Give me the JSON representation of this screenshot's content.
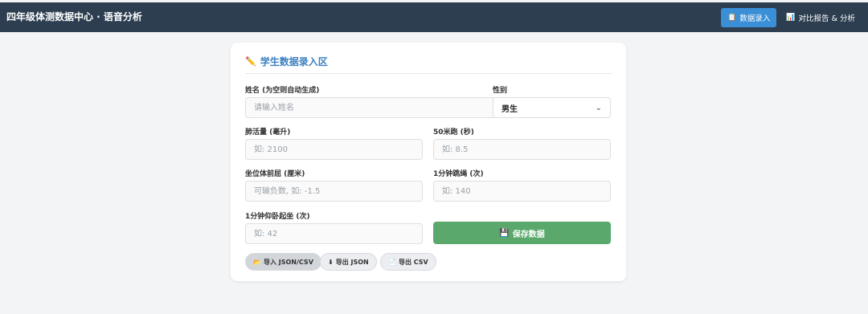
{
  "header": {
    "title": "四年级体测数据中心 · 语音分析",
    "nav": [
      {
        "icon": "📋",
        "icon_name": "clipboard-icon",
        "label": "数据录入",
        "active": true
      },
      {
        "icon": "📊",
        "icon_name": "bar-chart-icon",
        "label": "对比报告 & 分析",
        "active": false
      }
    ]
  },
  "form": {
    "title_icon": "✏️",
    "title": "学生数据录入区",
    "name": {
      "label": "姓名 (为空则自动生成)",
      "placeholder": "请输入姓名",
      "value": ""
    },
    "gender": {
      "label": "性别",
      "value": "男生",
      "chevron": "⌄"
    },
    "lung": {
      "label": "肺活量 (毫升)",
      "placeholder": "如: 2100",
      "value": ""
    },
    "run50": {
      "label": "50米跑 (秒)",
      "placeholder": "如: 8.5",
      "value": ""
    },
    "sitreach": {
      "label": "坐位体前屈 (厘米)",
      "placeholder": "可输负数, 如: -1.5",
      "value": ""
    },
    "rope": {
      "label": "1分钟跳绳 (次)",
      "placeholder": "如: 140",
      "value": ""
    },
    "situp": {
      "label": "1分钟仰卧起坐 (次)",
      "placeholder": "如: 42",
      "value": ""
    },
    "save": {
      "icon": "💾",
      "label": "保存数据"
    }
  },
  "actions": [
    {
      "icon": "📂",
      "icon_name": "folder-icon",
      "label": "导入 JSON/CSV"
    },
    {
      "icon": "⬇",
      "icon_name": "download-icon",
      "label": "导出 JSON"
    },
    {
      "icon": "📄",
      "icon_name": "document-icon",
      "label": "导出 CSV"
    }
  ],
  "colors": {
    "topbar": "#2c3e50",
    "active_nav": "#3a8fd6",
    "accent_title": "#3a7fc1",
    "save_button": "#5aa86b"
  }
}
